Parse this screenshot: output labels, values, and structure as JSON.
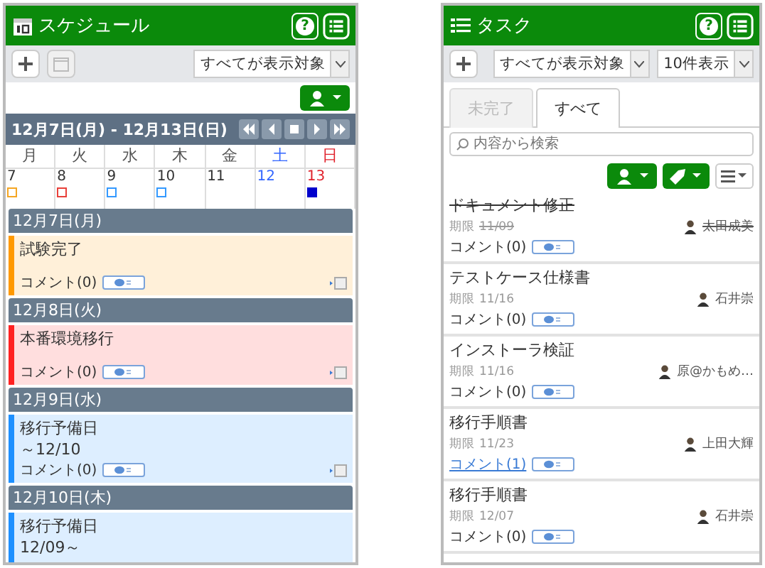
{
  "schedule": {
    "title": "スケジュール",
    "help": "?",
    "filter": "すべてが表示対象",
    "week_range": "12月7日(月) - 12月13日(日)",
    "weekdays": [
      {
        "label": "月",
        "color": "#555555"
      },
      {
        "label": "火",
        "color": "#555555"
      },
      {
        "label": "水",
        "color": "#555555"
      },
      {
        "label": "木",
        "color": "#555555"
      },
      {
        "label": "金",
        "color": "#555555"
      },
      {
        "label": "土",
        "color": "#3366ff"
      },
      {
        "label": "日",
        "color": "#e0202a"
      }
    ],
    "dates": [
      {
        "day": "7",
        "color": "#333333",
        "marker": {
          "color": "#f5a623",
          "filled": false
        }
      },
      {
        "day": "8",
        "color": "#333333",
        "marker": {
          "color": "#e8403a",
          "filled": false
        }
      },
      {
        "day": "9",
        "color": "#333333",
        "marker": {
          "color": "#3399ff",
          "filled": false
        }
      },
      {
        "day": "10",
        "color": "#333333",
        "marker": {
          "color": "#3399ff",
          "filled": false
        }
      },
      {
        "day": "11",
        "color": "#333333"
      },
      {
        "day": "12",
        "color": "#3366ff"
      },
      {
        "day": "13",
        "color": "#e0202a",
        "marker": {
          "color": "#0000cc",
          "filled": true
        }
      }
    ],
    "days": [
      {
        "heading": "12月7日(月)",
        "events": [
          {
            "title": "試験完了",
            "color": "#ff9900",
            "comments": "コメント(0)"
          }
        ]
      },
      {
        "heading": "12月8日(火)",
        "events": [
          {
            "title": "本番環境移行",
            "color": "#ff2222",
            "comments": "コメント(0)"
          }
        ]
      },
      {
        "heading": "12月9日(水)",
        "events": [
          {
            "title": "移行予備日",
            "period": "～12/10",
            "color": "#1e90ff",
            "comments": "コメント(0)"
          }
        ]
      },
      {
        "heading": "12月10日(木)",
        "events": [
          {
            "title": "移行予備日",
            "period": "12/09～",
            "color": "#1e90ff"
          }
        ]
      }
    ]
  },
  "tasks": {
    "title": "タスク",
    "help": "?",
    "filter": "すべてが表示対象",
    "page_size": "10件表示",
    "tabs": [
      {
        "label": "未完了",
        "selected": false
      },
      {
        "label": "すべて",
        "selected": true
      }
    ],
    "search": {
      "placeholder": "内容から検索"
    },
    "items": [
      {
        "title": "ドキュメント修正",
        "due_label": "期限",
        "due": "11/09",
        "done": true,
        "assignee": "太田成美",
        "comments": "コメント(0)",
        "has_comments": false
      },
      {
        "title": "テストケース仕様書",
        "due_label": "期限",
        "due": "11/16",
        "done": false,
        "assignee": "石井崇",
        "comments": "コメント(0)",
        "has_comments": false
      },
      {
        "title": "インストーラ検証",
        "due_label": "期限",
        "due": "11/16",
        "done": false,
        "assignee": "原@かもめ…",
        "comments": "コメント(0)",
        "has_comments": false
      },
      {
        "title": "移行手順書",
        "due_label": "期限",
        "due": "11/23",
        "done": false,
        "assignee": "上田大輝",
        "comments": "コメント(1)",
        "has_comments": true
      },
      {
        "title": "移行手順書",
        "due_label": "期限",
        "due": "12/07",
        "done": false,
        "assignee": "石井崇",
        "comments": "コメント(0)",
        "has_comments": false
      }
    ]
  }
}
